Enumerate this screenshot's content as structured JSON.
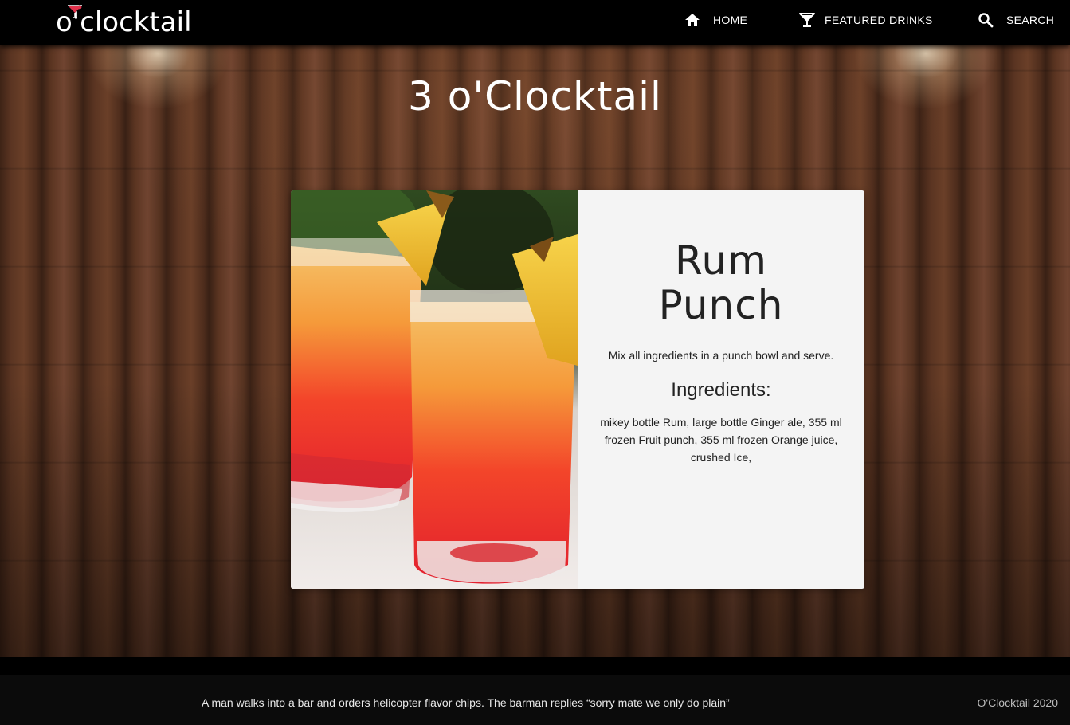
{
  "nav": {
    "logo_text": "o'clocktail",
    "items": [
      {
        "label": "HOME",
        "icon": "home-icon"
      },
      {
        "label": "FEATURED DRINKS",
        "icon": "cocktail-glass-icon"
      },
      {
        "label": "SEARCH",
        "icon": "search-icon"
      }
    ]
  },
  "hero": {
    "title": "3 o'Clocktail"
  },
  "drink": {
    "name_line1": "Rum",
    "name_line2": "Punch",
    "instructions": "Mix all ingredients in a punch bowl and serve.",
    "ingredients_heading": "Ingredients:",
    "ingredients": "mikey bottle Rum, large bottle Ginger ale, 355 ml frozen Fruit punch, 355 ml frozen Orange juice, crushed Ice,",
    "image": "rum-punch-glasses-photo"
  },
  "footer": {
    "joke": "A man walks into a bar and orders helicopter flavor chips. The barman replies “sorry mate we only do plain”",
    "copyright": "O'Clocktail 2020"
  },
  "colors": {
    "nav_bg": "#000000",
    "card_bg": "#f4f4f4",
    "footer_bg": "#0b0b0b",
    "logo_accent": "#e0304a"
  }
}
